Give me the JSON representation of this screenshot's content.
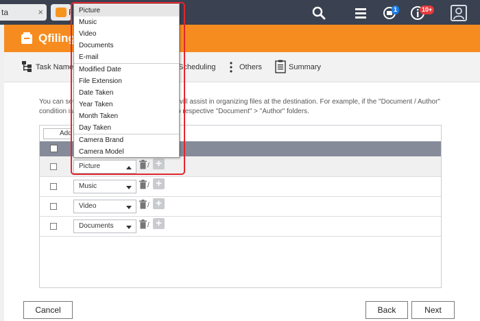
{
  "browser": {
    "tab1_label": "ta",
    "tab1_close": "×",
    "tab2_label": "F",
    "notification_badge_count": "1",
    "alerts_badge_count": "10+"
  },
  "app": {
    "title": "Qfiling",
    "accent_color": "#f68c1f"
  },
  "steps": {
    "task_name": "Task Name and ...",
    "scheduling": "Scheduling",
    "others": "Others",
    "summary": "Summary"
  },
  "description": {
    "line1_start": "You can set",
    "line1_end": "vill assist in organizing files at the destination. For example, if the \"Document / Author\"",
    "line2_start": "condition is",
    "line2_end": "o respective \"Document\" > \"Author\" folders."
  },
  "table": {
    "add_label": "Add",
    "rows": [
      {
        "value": "Picture",
        "open": true
      },
      {
        "value": "Music",
        "open": false
      },
      {
        "value": "Video",
        "open": false
      },
      {
        "value": "Documents",
        "open": false
      }
    ],
    "slash": "/",
    "plus": "+"
  },
  "dropdown": {
    "options": [
      "Picture",
      "Music",
      "Video",
      "Documents",
      "E-mail",
      "Modified Date",
      "File Extension",
      "Date Taken",
      "Year Taken",
      "Month Taken",
      "Day Taken",
      "Camera Brand",
      "Camera Model"
    ],
    "selected": "Picture"
  },
  "footer": {
    "cancel": "Cancel",
    "back": "Back",
    "next": "Next"
  }
}
